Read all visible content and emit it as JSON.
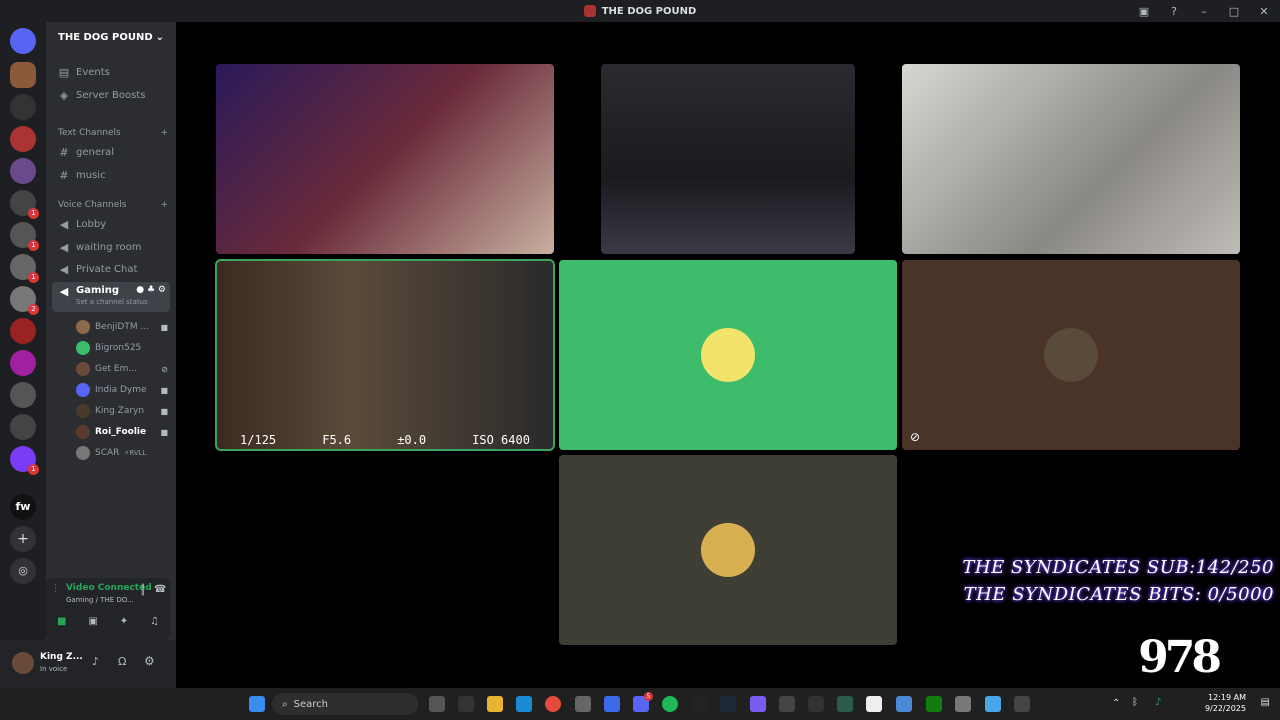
{
  "window": {
    "title": "THE DOG POUND"
  },
  "server": {
    "name": "THE DOG POUND"
  },
  "nav": {
    "events": "Events",
    "boosts": "Server Boosts"
  },
  "text_channels": {
    "label": "Text Channels",
    "items": [
      "general",
      "music"
    ]
  },
  "voice_channels": {
    "label": "Voice Channels",
    "items": [
      "Lobby",
      "waiting room",
      "Private Chat",
      "Gaming"
    ],
    "status_hint": "Set a channel status"
  },
  "members": [
    "BenjiDTM ...",
    "Bigron525",
    "Get Em...",
    "India Dyme",
    "King Zaryn",
    "Roi_Foolie",
    "SCAR"
  ],
  "member_tag": "⚡RVLL",
  "guild_badges": [
    "1",
    "1",
    "1",
    "2",
    "1"
  ],
  "voice": {
    "status": "Video Connected",
    "location": "Gaming / THE DO..."
  },
  "user": {
    "name": "King Z...",
    "status": "In voice"
  },
  "camera_hud": {
    "shutter": "1/125",
    "aperture": "F5.6",
    "exposure": "±0.0",
    "iso": "ISO 6400"
  },
  "overlay": {
    "subs": "THE SYNDICATES SUB:142/250",
    "bits": "THE SYNDICATES BITS: 0/5000"
  },
  "watermark": "978",
  "taskbar": {
    "search": "Search",
    "time": "12:19 AM",
    "date": "9/22/2025",
    "badge": "5"
  },
  "colors": {
    "green_tile": "#3dbd6b",
    "brown_tile": "#4a3328",
    "olive_tile": "#3f3e35",
    "accent": "#3ba55c"
  }
}
